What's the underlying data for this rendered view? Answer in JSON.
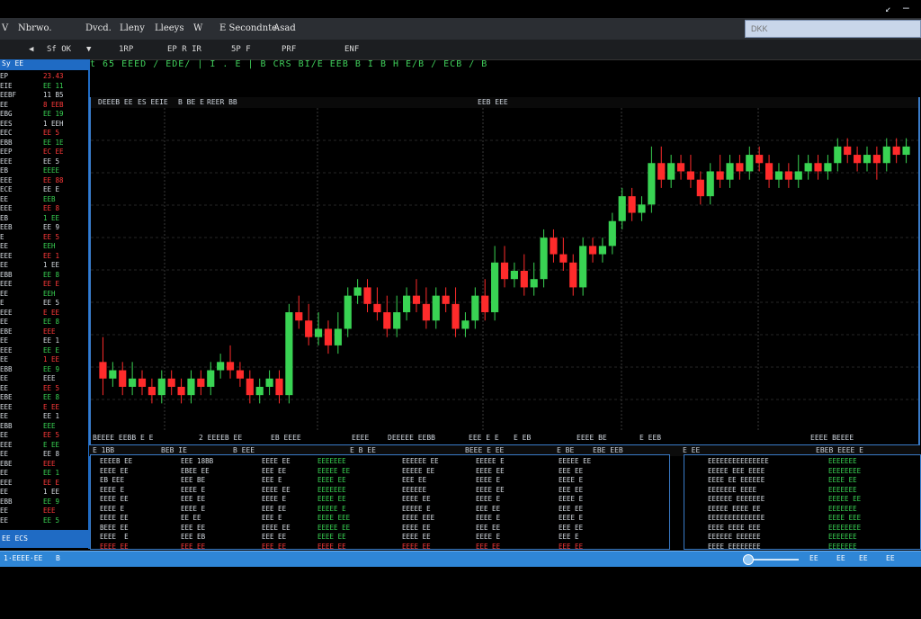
{
  "window": {
    "title_icons": [
      "minimize-icon",
      "close-icon"
    ]
  },
  "menu": {
    "app_mark": "V",
    "items": [
      "Nbrwo.",
      "Dvcd.",
      "Lleny",
      "Lleeys",
      "W",
      "E Secondnte",
      "Asad"
    ]
  },
  "search": {
    "placeholder": "DKK"
  },
  "toolbar": {
    "items": [
      "Sf OK",
      "1RP",
      "EP R IR",
      "5P F",
      "PRF",
      "ENF"
    ]
  },
  "ticker": {
    "text": "t 65  EEED   / EDE/ | I  .  E | B CRS      BI/E EEB      B I B  H  E/B / ECB /  B"
  },
  "watchlist": {
    "header": "Sy    EE",
    "footer": "EE  ECS",
    "rows": [
      [
        "EP",
        "23.43"
      ],
      [
        "EIE",
        "EE 11"
      ],
      [
        "EEBF",
        "11 B5"
      ],
      [
        "EE",
        "8 EEB"
      ],
      [
        "EBG",
        "EE 19"
      ],
      [
        "EES",
        "1 EEH"
      ],
      [
        "EEC",
        "EE 5"
      ],
      [
        "EBB",
        "EE 1E"
      ],
      [
        "EEP",
        "EC EE"
      ],
      [
        "EEE",
        "EE 5"
      ],
      [
        "EB",
        "EEEE"
      ],
      [
        "EEE",
        "EE 88"
      ],
      [
        "ECE",
        "EE E"
      ],
      [
        "EE",
        "EEB"
      ],
      [
        "EEE",
        "EE 8"
      ],
      [
        "EB",
        "1 EE"
      ],
      [
        "EEB",
        "EE 9"
      ],
      [
        "E",
        "EE 5"
      ],
      [
        "EE",
        "EEH"
      ],
      [
        "EEE",
        "EE 1"
      ],
      [
        "EE",
        "1 EE"
      ],
      [
        "EBB",
        "EE 8"
      ],
      [
        "EEE",
        "EE E"
      ],
      [
        "EE",
        "EEH"
      ],
      [
        "E",
        "EE 5"
      ],
      [
        "EEE",
        "E EE"
      ],
      [
        "EE",
        "EE 8"
      ],
      [
        "EBE",
        "EEE"
      ],
      [
        "EE",
        "EE 1"
      ],
      [
        "EEE",
        "EE E"
      ],
      [
        "EE",
        "1 EE"
      ],
      [
        "EBB",
        "EE 9"
      ],
      [
        "EE",
        "EEE"
      ],
      [
        "EE",
        "EE 5"
      ],
      [
        "EBE",
        "EE 8"
      ],
      [
        "EEE",
        "E EE"
      ],
      [
        "EE",
        "EE 1"
      ],
      [
        "EBB",
        "EEE"
      ],
      [
        "EE",
        "EE 5"
      ],
      [
        "EEE",
        "E EE"
      ],
      [
        "EE",
        "EE 8"
      ],
      [
        "EBE",
        "EEE"
      ],
      [
        "EE",
        "EE 1"
      ],
      [
        "EEE",
        "EE E"
      ],
      [
        "EE",
        "1 EE"
      ],
      [
        "EBB",
        "EE 9"
      ],
      [
        "EE",
        "EEE"
      ],
      [
        "EE",
        "EE 5"
      ]
    ],
    "row_colors": [
      "red",
      "green",
      "white",
      "red",
      "green",
      "white",
      "red",
      "green",
      "red",
      "white",
      "green",
      "red",
      "white",
      "green",
      "red",
      "green",
      "white",
      "red",
      "green",
      "red",
      "white",
      "green",
      "red",
      "green",
      "white",
      "red",
      "green",
      "red",
      "white",
      "green",
      "red",
      "green",
      "white",
      "red",
      "green",
      "red",
      "white",
      "green",
      "red",
      "green",
      "white",
      "red",
      "green",
      "red",
      "white",
      "green",
      "red",
      "green"
    ]
  },
  "chart": {
    "header": [
      "DEEEB EE",
      "ES EEIE",
      "B BE E",
      "REER BB"
    ],
    "header_right": "EEB EEE",
    "xaxis": [
      "BEEEE EEBB  E     E",
      "2 EEEEB EE",
      "EB EEEE",
      "EEEE",
      "DEEEEE EEBB",
      "EEE E  E",
      "E  EB",
      "EEEE BE",
      "E EEB",
      "EEEE  BEEEE"
    ],
    "bottom_head": [
      "E  1BB",
      "BEB IE",
      "B  EEE",
      "E  B EE",
      "BEEE E EE",
      "E   BE",
      "EBE   EEB",
      "E  EE",
      "EBEB EEEE E"
    ]
  },
  "chart_data": {
    "type": "candlestick",
    "title": "",
    "candles": [
      [
        38,
        36,
        41,
        34
      ],
      [
        36,
        37,
        38,
        35
      ],
      [
        37,
        35,
        38,
        34
      ],
      [
        35,
        36,
        38,
        34
      ],
      [
        36,
        35,
        37,
        34
      ],
      [
        35,
        34,
        36,
        33
      ],
      [
        34,
        36,
        37,
        33
      ],
      [
        36,
        35,
        37,
        34
      ],
      [
        35,
        34,
        36,
        33
      ],
      [
        34,
        36,
        37,
        33
      ],
      [
        36,
        35,
        37,
        34
      ],
      [
        35,
        37,
        38,
        34
      ],
      [
        37,
        38,
        39,
        36
      ],
      [
        38,
        37,
        40,
        36
      ],
      [
        37,
        36,
        38,
        35
      ],
      [
        36,
        34,
        37,
        33
      ],
      [
        34,
        35,
        36,
        33
      ],
      [
        35,
        36,
        37,
        34
      ],
      [
        36,
        34,
        37,
        33
      ],
      [
        34,
        44,
        45,
        33
      ],
      [
        44,
        43,
        46,
        42
      ],
      [
        43,
        41,
        45,
        40
      ],
      [
        41,
        42,
        44,
        40
      ],
      [
        42,
        40,
        43,
        39
      ],
      [
        40,
        42,
        44,
        39
      ],
      [
        42,
        46,
        47,
        41
      ],
      [
        46,
        47,
        48,
        45
      ],
      [
        47,
        45,
        48,
        44
      ],
      [
        45,
        44,
        47,
        43
      ],
      [
        44,
        42,
        46,
        41
      ],
      [
        42,
        44,
        46,
        41
      ],
      [
        44,
        46,
        47,
        43
      ],
      [
        46,
        45,
        48,
        44
      ],
      [
        45,
        43,
        47,
        42
      ],
      [
        43,
        46,
        47,
        42
      ],
      [
        46,
        45,
        47,
        44
      ],
      [
        45,
        42,
        47,
        41
      ],
      [
        42,
        43,
        44,
        41
      ],
      [
        43,
        46,
        47,
        42
      ],
      [
        46,
        44,
        48,
        43
      ],
      [
        44,
        50,
        52,
        43
      ],
      [
        50,
        48,
        52,
        47
      ],
      [
        48,
        49,
        50,
        47
      ],
      [
        49,
        47,
        51,
        46
      ],
      [
        47,
        48,
        50,
        46
      ],
      [
        48,
        53,
        54,
        47
      ],
      [
        53,
        51,
        54,
        50
      ],
      [
        51,
        50,
        53,
        49
      ],
      [
        50,
        47,
        51,
        46
      ],
      [
        47,
        52,
        53,
        46
      ],
      [
        52,
        51,
        53,
        50
      ],
      [
        51,
        52,
        53,
        50
      ],
      [
        52,
        55,
        56,
        51
      ],
      [
        55,
        58,
        59,
        54
      ],
      [
        58,
        56,
        59,
        55
      ],
      [
        56,
        57,
        58,
        55
      ],
      [
        57,
        62,
        64,
        56
      ],
      [
        62,
        60,
        64,
        59
      ],
      [
        60,
        62,
        63,
        59
      ],
      [
        62,
        61,
        63,
        60
      ],
      [
        61,
        60,
        63,
        59
      ],
      [
        60,
        58,
        61,
        57
      ],
      [
        58,
        61,
        62,
        57
      ],
      [
        61,
        60,
        63,
        59
      ],
      [
        60,
        62,
        63,
        59
      ],
      [
        62,
        61,
        63,
        60
      ],
      [
        61,
        63,
        64,
        60
      ],
      [
        63,
        62,
        64,
        61
      ],
      [
        62,
        60,
        63,
        59
      ],
      [
        60,
        61,
        62,
        59
      ],
      [
        61,
        60,
        62,
        59
      ],
      [
        60,
        61,
        63,
        59
      ],
      [
        61,
        62,
        63,
        60
      ],
      [
        62,
        61,
        63,
        60
      ],
      [
        61,
        62,
        63,
        60
      ],
      [
        62,
        64,
        65,
        61
      ],
      [
        64,
        63,
        65,
        62
      ],
      [
        63,
        62,
        64,
        61
      ],
      [
        62,
        63,
        64,
        61
      ],
      [
        63,
        62,
        64,
        60
      ],
      [
        62,
        64,
        65,
        61
      ],
      [
        64,
        63,
        65,
        62
      ],
      [
        63,
        64,
        65,
        62
      ]
    ],
    "up_color": "#39d353",
    "down_color": "#ff2b2b",
    "grid": true,
    "ylim": [
      30,
      68
    ]
  },
  "orders": {
    "columns": [
      [
        "EEEEB EE",
        "EEEE EE",
        "EB EEE",
        "EEEE E",
        "EEEE EE",
        "EEEE E",
        "EEEE EE",
        "BEEE EE",
        "EEEE  E",
        "EEEE EE"
      ],
      [
        "EEE 18BB",
        "EBEE EE",
        "EEE BE",
        "EEEE E",
        "EEE EE",
        "EEEE E",
        "EE EE",
        "EEE EE",
        "EEE EB",
        "EEE EE"
      ],
      [
        "EEEE EE",
        "EEE EE",
        "EEE E",
        "EEEE EE",
        "EEEE E",
        "EEE EE",
        "EEE E",
        "EEEE EE",
        "EEE EE",
        "EEE EE"
      ],
      [
        "EEEEEEE",
        "EEEEE EE",
        "EEEE EE",
        "EEEEEEE",
        "EEEE EE",
        "EEEEE E",
        "EEEE EEE",
        "EEEEE EE",
        "EEEE EE",
        "EEEE EE"
      ],
      [
        "EEEEEE EE",
        "EEEEE EE",
        "EEE EE",
        "EEEEEE",
        "EEEE EE",
        "EEEEE E",
        "EEEE EEE",
        "EEEE EE",
        "EEEE EE",
        "EEEE EE"
      ],
      [
        "EEEEE E",
        "EEEE EE",
        "EEEE E",
        "EEEE EE",
        "EEEE E",
        "EEE EE",
        "EEEE E",
        "EEE EE",
        "EEEE E",
        "EEE EE"
      ],
      [
        "EEEEE EE",
        "EEE EE",
        "EEEE E",
        "EEE EE",
        "EEEE E",
        "EEE EE",
        "EEEE E",
        "EEE EE",
        "EEE E",
        "EEE EE"
      ]
    ],
    "column_colors": [
      "white",
      "white",
      "white",
      "green",
      "white",
      "white",
      "white"
    ]
  },
  "positions": {
    "left": [
      "EEEEEEEEEEEEEEE",
      "EEEEE EEE EEEE",
      "EEEE EE EEEEEE",
      "EEEEEEE EEEE",
      "EEEEEE EEEEEEE",
      "EEEEE EEEE EE",
      "EEEEEEEEEEEEEE",
      "EEEE EEEE EEE",
      "EEEEEE EEEEEE",
      "EEEE EEEEEEEE"
    ],
    "right": [
      "EEEEEEE",
      "EEEEEEEE",
      "EEEE EE",
      "EEEEEEE",
      "EEEEE EE",
      "EEEEEEE",
      "EEEE EEE",
      "EEEEEEEE",
      "EEEEEEE",
      "EEEEEEE"
    ]
  },
  "status": {
    "left": "1·EEEE·EE",
    "mid": "B",
    "right_items": [
      "EE",
      "EE",
      "EE",
      "EE"
    ]
  }
}
